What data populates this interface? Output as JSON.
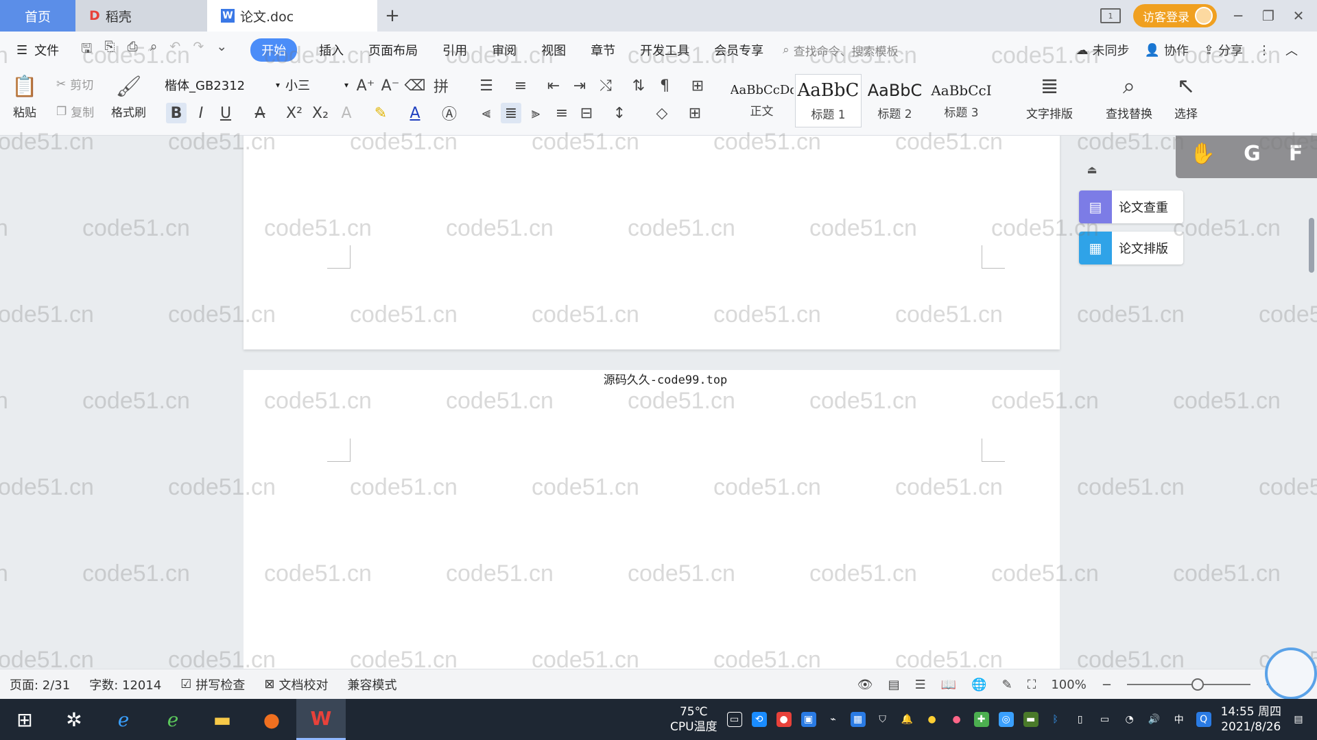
{
  "titlebar": {
    "tabs": [
      {
        "label": "首页"
      },
      {
        "label": "稻壳"
      },
      {
        "label": "论文.doc"
      }
    ],
    "page_indicator": "1",
    "guest_login": "访客登录"
  },
  "menubar": {
    "file": "文件",
    "items": [
      "开始",
      "插入",
      "页面布局",
      "引用",
      "审阅",
      "视图",
      "章节",
      "开发工具",
      "会员专享"
    ],
    "search_placeholder": "查找命令、搜索模板",
    "right": {
      "sync": "未同步",
      "collab": "协作",
      "share": "分享"
    }
  },
  "ribbon": {
    "paste": "粘贴",
    "cut": "剪切",
    "copy": "复制",
    "format_painter": "格式刷",
    "font_name": "楷体_GB2312",
    "font_size": "小三",
    "styles": [
      {
        "sample": "AaBbCcDd",
        "label": "正文"
      },
      {
        "sample": "AaBbC",
        "label": "标题 1"
      },
      {
        "sample": "AaBbC",
        "label": "标题 2"
      },
      {
        "sample": "AaBbCcI",
        "label": "标题 3"
      }
    ],
    "text_layout": "文字排版",
    "find_replace": "查找替换",
    "select": "选择"
  },
  "document": {
    "between_pages_text": "源码久久-code99.top"
  },
  "side_panel": {
    "check": "论文查重",
    "format": "论文排版",
    "floating_letters": [
      "G",
      "F"
    ]
  },
  "watermark": "code51.cn",
  "statusbar": {
    "page": "页面: 2/31",
    "words": "字数: 12014",
    "spell": "拼写检查",
    "proof": "文档校对",
    "compat": "兼容模式",
    "zoom": "100%"
  },
  "taskbar": {
    "cpu_temp": "75℃",
    "cpu_label": "CPU温度",
    "time": "14:55 周四",
    "date": "2021/8/26",
    "ime": "中"
  },
  "colors": {
    "accent": "#4b8df8",
    "guest": "#f0a020",
    "taskbar": "#1e2733",
    "check_icon": "#7c7ce6",
    "format_icon": "#2fa3e8"
  }
}
